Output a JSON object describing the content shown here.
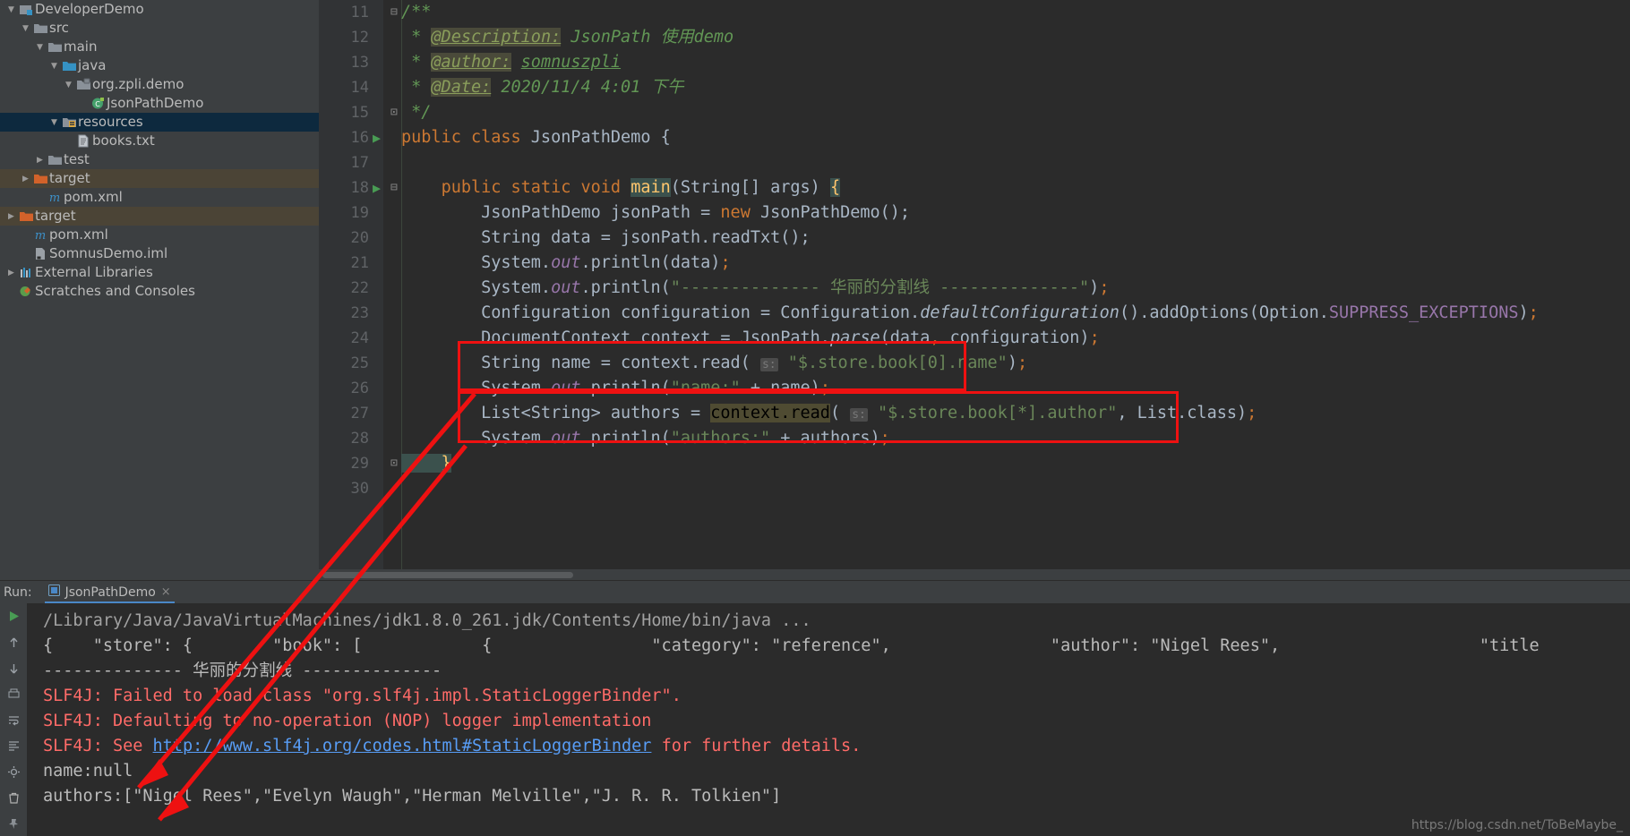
{
  "project_tree": {
    "items": [
      {
        "label": "DeveloperDemo",
        "indent": 0,
        "arrow": "down",
        "icon": "module-icon",
        "state": "normal"
      },
      {
        "label": "src",
        "indent": 1,
        "arrow": "down",
        "icon": "folder-gray-icon",
        "state": "normal"
      },
      {
        "label": "main",
        "indent": 2,
        "arrow": "down",
        "icon": "folder-gray-icon",
        "state": "normal"
      },
      {
        "label": "java",
        "indent": 3,
        "arrow": "down",
        "icon": "folder-source-icon",
        "state": "normal"
      },
      {
        "label": "org.zpli.demo",
        "indent": 4,
        "arrow": "down",
        "icon": "package-icon",
        "state": "normal"
      },
      {
        "label": "JsonPathDemo",
        "indent": 5,
        "arrow": "none",
        "icon": "java-class-icon",
        "state": "normal"
      },
      {
        "label": "resources",
        "indent": 3,
        "arrow": "down",
        "icon": "folder-resources-icon",
        "state": "selected"
      },
      {
        "label": "books.txt",
        "indent": 4,
        "arrow": "none",
        "icon": "text-file-icon",
        "state": "normal"
      },
      {
        "label": "test",
        "indent": 2,
        "arrow": "right",
        "icon": "folder-gray-icon",
        "state": "normal"
      },
      {
        "label": "target",
        "indent": 1,
        "arrow": "right",
        "icon": "folder-orange-icon",
        "state": "excluded"
      },
      {
        "label": "pom.xml",
        "indent": 2,
        "arrow": "none",
        "icon": "maven-icon",
        "state": "normal"
      },
      {
        "label": "target",
        "indent": 0,
        "arrow": "right",
        "icon": "folder-orange-icon",
        "state": "excluded"
      },
      {
        "label": "pom.xml",
        "indent": 1,
        "arrow": "none",
        "icon": "maven-icon",
        "state": "normal"
      },
      {
        "label": "SomnusDemo.iml",
        "indent": 1,
        "arrow": "none",
        "icon": "iml-file-icon",
        "state": "normal"
      },
      {
        "label": "External Libraries",
        "indent": 0,
        "arrow": "right",
        "icon": "libraries-icon",
        "state": "normal"
      },
      {
        "label": "Scratches and Consoles",
        "indent": 0,
        "arrow": "none",
        "icon": "scratches-icon",
        "state": "normal"
      }
    ]
  },
  "editor": {
    "lines": [
      {
        "num": "11",
        "tokens": [
          {
            "t": "/**",
            "c": "cmt"
          }
        ],
        "gutter": "fold-open",
        "extra": "structure"
      },
      {
        "num": "12",
        "tokens": [
          {
            "t": " * ",
            "c": "cmt"
          },
          {
            "t": "@Description:",
            "c": "tag"
          },
          {
            "t": " JsonPath 使用demo",
            "c": "cmtv"
          }
        ]
      },
      {
        "num": "13",
        "tokens": [
          {
            "t": " * ",
            "c": "cmt"
          },
          {
            "t": "@author:",
            "c": "tag"
          },
          {
            "t": " ",
            "c": "cmtv"
          },
          {
            "t": "somnuszpli",
            "c": "usr"
          }
        ]
      },
      {
        "num": "14",
        "tokens": [
          {
            "t": " * ",
            "c": "cmt"
          },
          {
            "t": "@Date:",
            "c": "tag"
          },
          {
            "t": " 2020/11/4 4:01 下午",
            "c": "cmtv"
          }
        ]
      },
      {
        "num": "15",
        "tokens": [
          {
            "t": " */",
            "c": "cmt"
          }
        ],
        "gutter": "fold-close"
      },
      {
        "num": "16",
        "tokens": [
          {
            "t": "public class ",
            "c": "kw"
          },
          {
            "t": "JsonPathDemo",
            "c": "id"
          },
          {
            "t": " {",
            "c": "id"
          }
        ],
        "run": true
      },
      {
        "num": "17",
        "tokens": []
      },
      {
        "num": "18",
        "tokens": [
          {
            "t": "    ",
            "c": "id"
          },
          {
            "t": "public static void ",
            "c": "kw"
          },
          {
            "t": "main",
            "c": "ylw"
          },
          {
            "t": "(String[] args) ",
            "c": "id"
          },
          {
            "t": "{",
            "c": "brace"
          }
        ],
        "run": true,
        "gutter": "fold-open"
      },
      {
        "num": "19",
        "tokens": [
          {
            "t": "        JsonPathDemo jsonPath = ",
            "c": "id"
          },
          {
            "t": "new ",
            "c": "kw"
          },
          {
            "t": "JsonPathDemo();",
            "c": "id"
          }
        ]
      },
      {
        "num": "20",
        "tokens": [
          {
            "t": "        String data = jsonPath.readTxt();",
            "c": "id"
          }
        ]
      },
      {
        "num": "21",
        "tokens": [
          {
            "t": "        System.",
            "c": "id"
          },
          {
            "t": "out",
            "c": "fld"
          },
          {
            "t": ".println(data)",
            "c": "id"
          },
          {
            "t": ";",
            "c": "semi"
          }
        ]
      },
      {
        "num": "22",
        "tokens": [
          {
            "t": "        System.",
            "c": "id"
          },
          {
            "t": "out",
            "c": "fld"
          },
          {
            "t": ".println(",
            "c": "id"
          },
          {
            "t": "\"-------------- 华丽的分割线 --------------\"",
            "c": "str"
          },
          {
            "t": ")",
            "c": "id"
          },
          {
            "t": ";",
            "c": "semi"
          }
        ]
      },
      {
        "num": "23",
        "tokens": [
          {
            "t": "        Configuration configuration = Configuration.",
            "c": "id"
          },
          {
            "t": "defaultConfiguration",
            "c": "mth"
          },
          {
            "t": "().addOptions(Option.",
            "c": "id"
          },
          {
            "t": "SUPPRESS_EXCEPTIONS",
            "c": "cst"
          },
          {
            "t": ")",
            "c": "id"
          },
          {
            "t": ";",
            "c": "semi"
          }
        ]
      },
      {
        "num": "24",
        "tokens": [
          {
            "t": "        DocumentContext context = JsonPath.",
            "c": "id"
          },
          {
            "t": "parse",
            "c": "mth"
          },
          {
            "t": "(data",
            "c": "id"
          },
          {
            "t": ",",
            "c": "semi"
          },
          {
            "t": " configuration)",
            "c": "id"
          },
          {
            "t": ";",
            "c": "semi"
          }
        ]
      },
      {
        "num": "25",
        "tokens": [
          {
            "t": "        String name = context.read( ",
            "c": "id"
          },
          {
            "t": "s:",
            "c": "hint"
          },
          {
            "t": " ",
            "c": "id"
          },
          {
            "t": "\"$.store.book[0].name\"",
            "c": "str"
          },
          {
            "t": ")",
            "c": "id"
          },
          {
            "t": ";",
            "c": "semi"
          }
        ]
      },
      {
        "num": "26",
        "tokens": [
          {
            "t": "        System.",
            "c": "id"
          },
          {
            "t": "out",
            "c": "fld"
          },
          {
            "t": ".println(",
            "c": "id"
          },
          {
            "t": "\"name:\"",
            "c": "str"
          },
          {
            "t": " + name)",
            "c": "id"
          },
          {
            "t": ";",
            "c": "semi"
          }
        ]
      },
      {
        "num": "27",
        "tokens": [
          {
            "t": "        List<String> authors = ",
            "c": "id"
          },
          {
            "t": "context.read",
            "c": "hl"
          },
          {
            "t": "( ",
            "c": "id"
          },
          {
            "t": "s:",
            "c": "hint"
          },
          {
            "t": " ",
            "c": "id"
          },
          {
            "t": "\"$.store.book[*].author\"",
            "c": "str"
          },
          {
            "t": ", List.class)",
            "c": "id"
          },
          {
            "t": ";",
            "c": "semi"
          }
        ]
      },
      {
        "num": "28",
        "tokens": [
          {
            "t": "        System.",
            "c": "id"
          },
          {
            "t": "out",
            "c": "fld"
          },
          {
            "t": ".println(",
            "c": "id"
          },
          {
            "t": "\"authors:\"",
            "c": "str"
          },
          {
            "t": " + authors)",
            "c": "id"
          },
          {
            "t": ";",
            "c": "semi"
          }
        ]
      },
      {
        "num": "29",
        "tokens": [
          {
            "t": "    }",
            "c": "cursorbr"
          }
        ],
        "gutter": "fold-close"
      },
      {
        "num": "30",
        "tokens": []
      }
    ]
  },
  "run_panel": {
    "run_label": "Run:",
    "tab_label": "JsonPathDemo",
    "close_icon": "×",
    "toolbar_icons": [
      "rerun-icon",
      "scroll-up-icon",
      "scroll-down-icon",
      "print-icon",
      "soft-wrap-icon",
      "scroll-to-end-icon",
      "settings-icon",
      "trash-icon",
      "pin-icon"
    ],
    "console_lines": [
      {
        "text": "/Library/Java/JavaVirtualMachines/jdk1.8.0_261.jdk/Contents/Home/bin/java ...",
        "color": "gray"
      },
      {
        "text": "{    \"store\": {        \"book\": [            {                \"category\": \"reference\",                \"author\": \"Nigel Rees\",                    \"title",
        "color": "white"
      },
      {
        "text": "-------------- 华丽的分割线 --------------",
        "color": "white"
      },
      {
        "text": "SLF4J: Failed to load class \"org.slf4j.impl.StaticLoggerBinder\".",
        "color": "red"
      },
      {
        "text": "SLF4J: Defaulting to no-operation (NOP) logger implementation",
        "color": "red"
      },
      {
        "text": "SLF4J: See ",
        "color": "red",
        "link": "http://www.slf4j.org/codes.html#StaticLoggerBinder",
        "tail": " for further details."
      },
      {
        "text": "name:null",
        "color": "white"
      },
      {
        "text": "authors:[\"Nigel Rees\",\"Evelyn Waugh\",\"Herman Melville\",\"J. R. R. Tolkien\"]",
        "color": "white"
      }
    ],
    "watermark": "https://blog.csdn.net/ToBeMaybe_"
  },
  "colors": {
    "background": "#2b2b2b",
    "panel": "#3c3f41",
    "selection": "#0d293e",
    "excluded": "#4b4436",
    "keyword": "#cc7832",
    "string": "#6a8759",
    "comment": "#629755",
    "field": "#9876aa",
    "error": "#ff6b68",
    "link": "#589df6",
    "annotation": "#ee1111",
    "accent": "#4a88c7"
  }
}
